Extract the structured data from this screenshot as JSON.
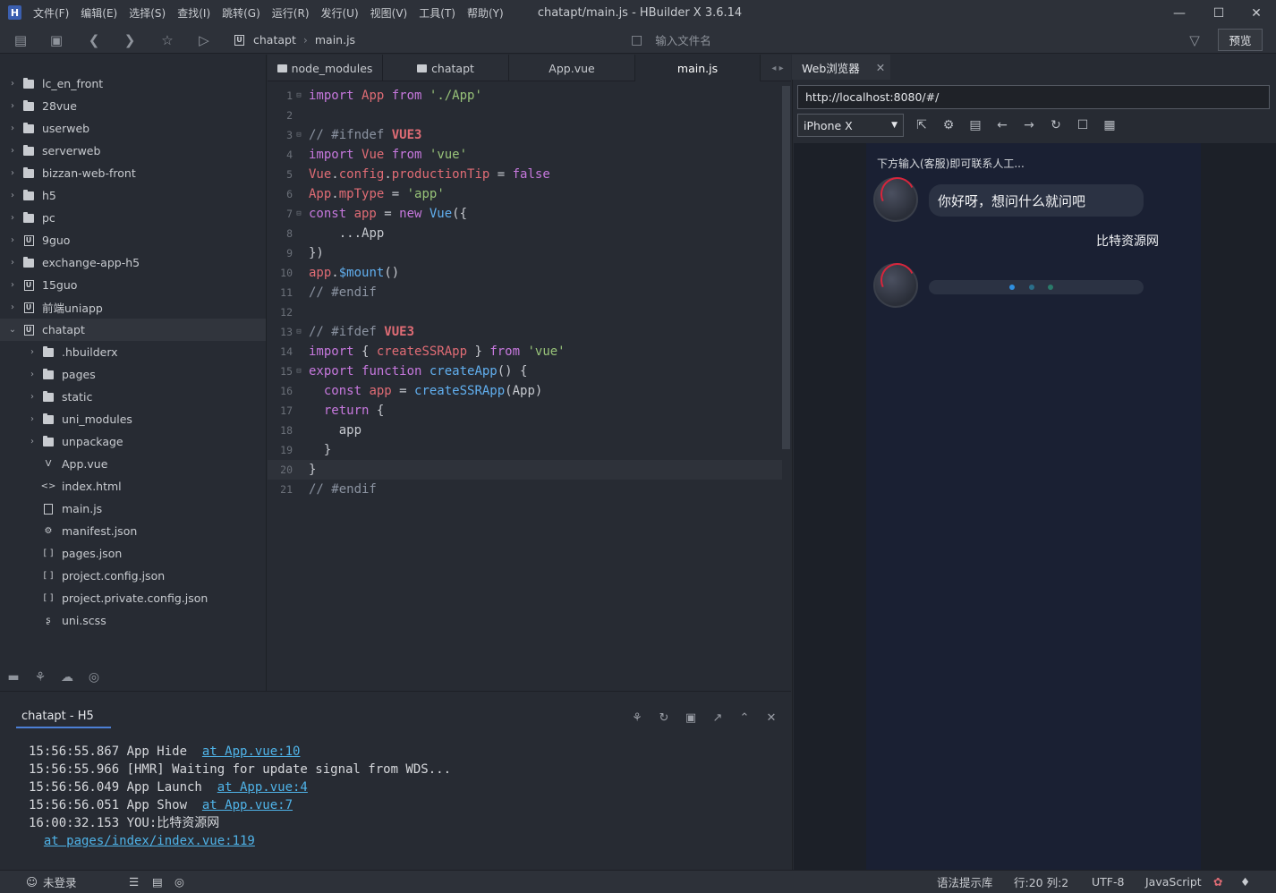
{
  "app": {
    "logo": "H",
    "title": "chatapt/main.js - HBuilder X 3.6.14",
    "menu": [
      "文件(F)",
      "编辑(E)",
      "选择(S)",
      "查找(I)",
      "跳转(G)",
      "运行(R)",
      "发行(U)",
      "视图(V)",
      "工具(T)",
      "帮助(Y)"
    ]
  },
  "toolbar": {
    "project_badge": "U",
    "breadcrumb": [
      "chatapt",
      "main.js"
    ],
    "file_search_placeholder": "输入文件名",
    "preview_label": "预览"
  },
  "sidebar": {
    "tree": [
      {
        "label": "lc_en_front",
        "icon": "folder",
        "level": 0,
        "chevron": "›"
      },
      {
        "label": "28vue",
        "icon": "folder",
        "level": 0,
        "chevron": "›"
      },
      {
        "label": "userweb",
        "icon": "folder",
        "level": 0,
        "chevron": "›"
      },
      {
        "label": "serverweb",
        "icon": "folder",
        "level": 0,
        "chevron": "›"
      },
      {
        "label": "bizzan-web-front",
        "icon": "folder",
        "level": 0,
        "chevron": "›"
      },
      {
        "label": "h5",
        "icon": "folder",
        "level": 0,
        "chevron": "›"
      },
      {
        "label": "pc",
        "icon": "folder",
        "level": 0,
        "chevron": "›"
      },
      {
        "label": "9guo",
        "icon": "uni",
        "level": 0,
        "chevron": "›"
      },
      {
        "label": "exchange-app-h5",
        "icon": "folder",
        "level": 0,
        "chevron": "›"
      },
      {
        "label": "15guo",
        "icon": "uni",
        "level": 0,
        "chevron": "›"
      },
      {
        "label": "前端uniapp",
        "icon": "uni",
        "level": 0,
        "chevron": "›"
      },
      {
        "label": "chatapt",
        "icon": "uni",
        "level": 0,
        "chevron": "⌄",
        "selected": true
      },
      {
        "label": ".hbuilderx",
        "icon": "folder",
        "level": 1,
        "chevron": "›"
      },
      {
        "label": "pages",
        "icon": "folder",
        "level": 1,
        "chevron": "›"
      },
      {
        "label": "static",
        "icon": "folder",
        "level": 1,
        "chevron": "›"
      },
      {
        "label": "uni_modules",
        "icon": "folder",
        "level": 1,
        "chevron": "›"
      },
      {
        "label": "unpackage",
        "icon": "folder",
        "level": 1,
        "chevron": "›"
      },
      {
        "label": "App.vue",
        "icon": "vue",
        "glyph": "V",
        "level": 1,
        "chevron": ""
      },
      {
        "label": "index.html",
        "icon": "html",
        "glyph": "<>",
        "level": 1,
        "chevron": ""
      },
      {
        "label": "main.js",
        "icon": "js",
        "glyph": "",
        "level": 1,
        "chevron": ""
      },
      {
        "label": "manifest.json",
        "icon": "manifest",
        "glyph": "⚙",
        "level": 1,
        "chevron": ""
      },
      {
        "label": "pages.json",
        "icon": "json",
        "glyph": "[ ]",
        "level": 1,
        "chevron": ""
      },
      {
        "label": "project.config.json",
        "icon": "json",
        "glyph": "[ ]",
        "level": 1,
        "chevron": ""
      },
      {
        "label": "project.private.config.json",
        "icon": "json",
        "glyph": "[ ]",
        "level": 1,
        "chevron": ""
      },
      {
        "label": "uni.scss",
        "icon": "scss",
        "glyph": "ʂ",
        "level": 1,
        "chevron": ""
      }
    ]
  },
  "editor": {
    "tabs": [
      {
        "label": "node_modules",
        "folder": true,
        "active": false
      },
      {
        "label": "chatapt",
        "folder": true,
        "active": false
      },
      {
        "label": "App.vue",
        "folder": false,
        "active": false
      },
      {
        "label": "main.js",
        "folder": false,
        "active": true
      }
    ],
    "tab_nav": "◂ ▸",
    "current_line": 20,
    "lines": [
      {
        "n": "1",
        "fold": "⊟",
        "tokens": [
          [
            "kw",
            "import "
          ],
          [
            "id",
            "App "
          ],
          [
            "kw",
            "from "
          ],
          [
            "str",
            "'./App'"
          ]
        ]
      },
      {
        "n": "2",
        "fold": "",
        "tokens": []
      },
      {
        "n": "3",
        "fold": "⊟",
        "tokens": [
          [
            "cm",
            "// #ifndef "
          ],
          [
            "dir",
            "VUE3"
          ]
        ]
      },
      {
        "n": "4",
        "fold": "",
        "tokens": [
          [
            "kw",
            "import "
          ],
          [
            "id",
            "Vue "
          ],
          [
            "kw",
            "from "
          ],
          [
            "str",
            "'vue'"
          ]
        ]
      },
      {
        "n": "5",
        "fold": "",
        "tokens": [
          [
            "id",
            "Vue"
          ],
          [
            "pl",
            "."
          ],
          [
            "id",
            "config"
          ],
          [
            "pl",
            "."
          ],
          [
            "id",
            "productionTip "
          ],
          [
            "pl",
            "= "
          ],
          [
            "kw",
            "false"
          ]
        ]
      },
      {
        "n": "6",
        "fold": "",
        "tokens": [
          [
            "id",
            "App"
          ],
          [
            "pl",
            "."
          ],
          [
            "id",
            "mpType "
          ],
          [
            "pl",
            "= "
          ],
          [
            "str",
            "'app'"
          ]
        ]
      },
      {
        "n": "7",
        "fold": "⊟",
        "tokens": [
          [
            "kw",
            "const "
          ],
          [
            "id",
            "app "
          ],
          [
            "pl",
            "= "
          ],
          [
            "kw",
            "new "
          ],
          [
            "fn",
            "Vue"
          ],
          [
            "pl",
            "({"
          ]
        ]
      },
      {
        "n": "8",
        "fold": "",
        "tokens": [
          [
            "pl",
            "    ..."
          ],
          [
            "pl",
            "App"
          ]
        ]
      },
      {
        "n": "9",
        "fold": "",
        "tokens": [
          [
            "pl",
            "})"
          ]
        ]
      },
      {
        "n": "10",
        "fold": "",
        "tokens": [
          [
            "id",
            "app"
          ],
          [
            "pl",
            "."
          ],
          [
            "fn",
            "$mount"
          ],
          [
            "pl",
            "()"
          ]
        ]
      },
      {
        "n": "11",
        "fold": "",
        "tokens": [
          [
            "cm",
            "// #endif"
          ]
        ]
      },
      {
        "n": "12",
        "fold": "",
        "tokens": []
      },
      {
        "n": "13",
        "fold": "⊟",
        "tokens": [
          [
            "cm",
            "// #ifdef "
          ],
          [
            "dir",
            "VUE3"
          ]
        ]
      },
      {
        "n": "14",
        "fold": "",
        "tokens": [
          [
            "kw",
            "import "
          ],
          [
            "pl",
            "{ "
          ],
          [
            "id",
            "createSSRApp "
          ],
          [
            "pl",
            "} "
          ],
          [
            "kw",
            "from "
          ],
          [
            "str",
            "'vue'"
          ]
        ]
      },
      {
        "n": "15",
        "fold": "⊟",
        "tokens": [
          [
            "kw",
            "export "
          ],
          [
            "kw",
            "function "
          ],
          [
            "fn",
            "createApp"
          ],
          [
            "pl",
            "() {"
          ]
        ]
      },
      {
        "n": "16",
        "fold": "",
        "tokens": [
          [
            "pl",
            "  "
          ],
          [
            "kw",
            "const "
          ],
          [
            "id",
            "app "
          ],
          [
            "pl",
            "= "
          ],
          [
            "fn",
            "createSSRApp"
          ],
          [
            "pl",
            "(App)"
          ]
        ]
      },
      {
        "n": "17",
        "fold": "",
        "tokens": [
          [
            "pl",
            "  "
          ],
          [
            "kw",
            "return "
          ],
          [
            "pl",
            "{"
          ]
        ]
      },
      {
        "n": "18",
        "fold": "",
        "tokens": [
          [
            "pl",
            "    app"
          ]
        ]
      },
      {
        "n": "19",
        "fold": "",
        "tokens": [
          [
            "pl",
            "  }"
          ]
        ]
      },
      {
        "n": "20",
        "fold": "",
        "tokens": [
          [
            "pl",
            "}"
          ]
        ]
      },
      {
        "n": "21",
        "fold": "",
        "tokens": [
          [
            "cm",
            "// #endif"
          ]
        ]
      }
    ]
  },
  "console": {
    "tab_label": "chatapt - H5",
    "logs": [
      {
        "text": "15:56:55.867 App Hide  ",
        "link": "at App.vue:10"
      },
      {
        "text": "15:56:55.966 [HMR] Waiting for update signal from WDS...",
        "link": ""
      },
      {
        "text": "15:56:56.049 App Launch  ",
        "link": "at App.vue:4"
      },
      {
        "text": "15:56:56.051 App Show  ",
        "link": "at App.vue:7"
      },
      {
        "text": "16:00:32.153 YOU:比特资源网",
        "link": ""
      },
      {
        "text": "  ",
        "link": "at pages/index/index.vue:119"
      }
    ]
  },
  "browser": {
    "tab_label": "Web浏览器",
    "url": "http://localhost:8080/#/",
    "device": "iPhone X",
    "chat": {
      "hint": "下方输入(客服)即可联系人工...",
      "bot_message": "你好呀，想问什么就问吧",
      "user_message": "比特资源网"
    }
  },
  "statusbar": {
    "login": "未登录",
    "syntax_lib": "语法提示库",
    "position": "行:20  列:2",
    "encoding": "UTF-8",
    "language": "JavaScript"
  },
  "colors": {
    "accent": "#4c7fd6",
    "link": "#4fb3e8",
    "keyword": "#c678dd",
    "string": "#98c379",
    "identifier": "#e06c75"
  }
}
